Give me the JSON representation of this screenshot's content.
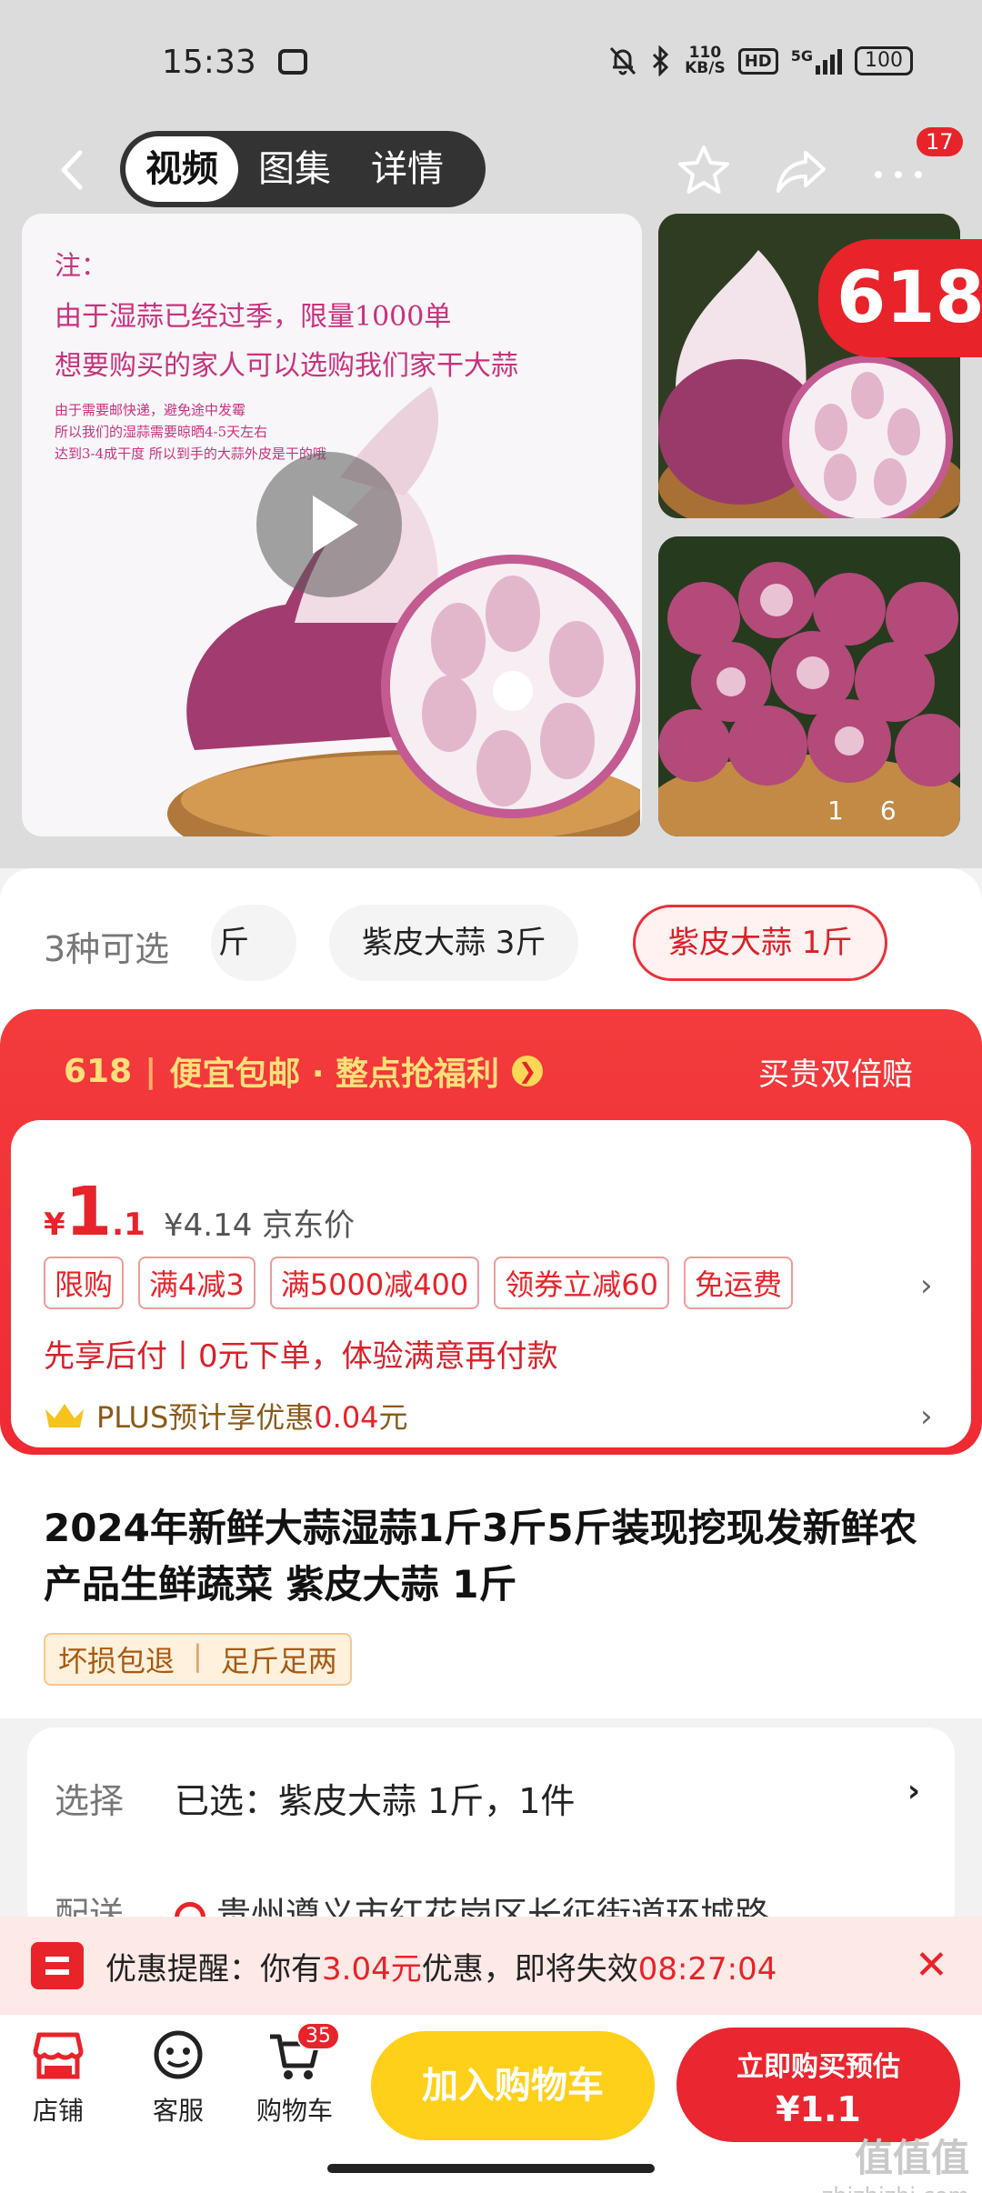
{
  "status": {
    "time": "15:33",
    "net_speed_value": "110",
    "net_speed_unit": "KB/S",
    "hd": "HD",
    "network": "5G",
    "battery": "100"
  },
  "nav": {
    "tabs": [
      "视频",
      "图集",
      "详情"
    ],
    "active_tab": "视频",
    "message_count": "17"
  },
  "gallery": {
    "note_line1": "注：",
    "note_line2": "由于湿蒜已经过季，限量1000单",
    "note_line3": "想要购买的家人可以选购我们家干大蒜",
    "note_small1": "由于需要邮快递，避免途中发霉",
    "note_small2": "所以我们的湿蒜需要晾晒4-5天左右",
    "note_small3": "达到3-4成干度 所以到手的大蒜外皮是干的哦",
    "badge": "618",
    "image_index": "1",
    "image_total": "6"
  },
  "variants": {
    "label": "3种可选",
    "options": [
      "斤",
      "紫皮大蒜 3斤",
      "紫皮大蒜 1斤"
    ],
    "selected": "紫皮大蒜 1斤"
  },
  "promo": {
    "event": "618",
    "headline": "便宜包邮 · 整点抢福利",
    "guarantee": "买贵双倍赔",
    "currency": "¥",
    "price_int": "1",
    "price_dec": ".1",
    "jd_price": "¥4.14",
    "jd_label": "京东价",
    "tags": [
      "限购",
      "满4减3",
      "满5000减400",
      "领券立减60",
      "免运费"
    ],
    "paylater": "先享后付丨0元下单，体验满意再付款",
    "plus_prefix": "PLUS预计享优惠",
    "plus_amount": "0.04",
    "plus_suffix": "元"
  },
  "product": {
    "title": "2024年新鲜大蒜湿蒜1斤3斤5斤装现挖现发新鲜农产品生鲜蔬菜 紫皮大蒜 1斤",
    "guarantees": [
      "坏损包退",
      "足斤足两"
    ]
  },
  "selection": {
    "select_label": "选择",
    "select_value": "已选：紫皮大蒜 1斤，1件",
    "delivery_label": "配送",
    "delivery_value": "贵州遵义市红花岗区长征街道环城路"
  },
  "reminder": {
    "prefix": "优惠提醒：你有",
    "amount": "3.04元",
    "middle": "优惠，即将失效",
    "countdown": "08:27:04"
  },
  "bottom": {
    "store": "店铺",
    "service": "客服",
    "cart": "购物车",
    "cart_count": "35",
    "add_to_cart": "加入购物车",
    "buy_now": "立即购买预估",
    "buy_price": "¥1.1"
  },
  "watermark": {
    "line1": "值值值",
    "line2": "zhizhizhi.com"
  },
  "colors": {
    "accent_red": "#e8232a",
    "cart_yellow": "#ffd01a",
    "note_pink": "#c8327e"
  }
}
